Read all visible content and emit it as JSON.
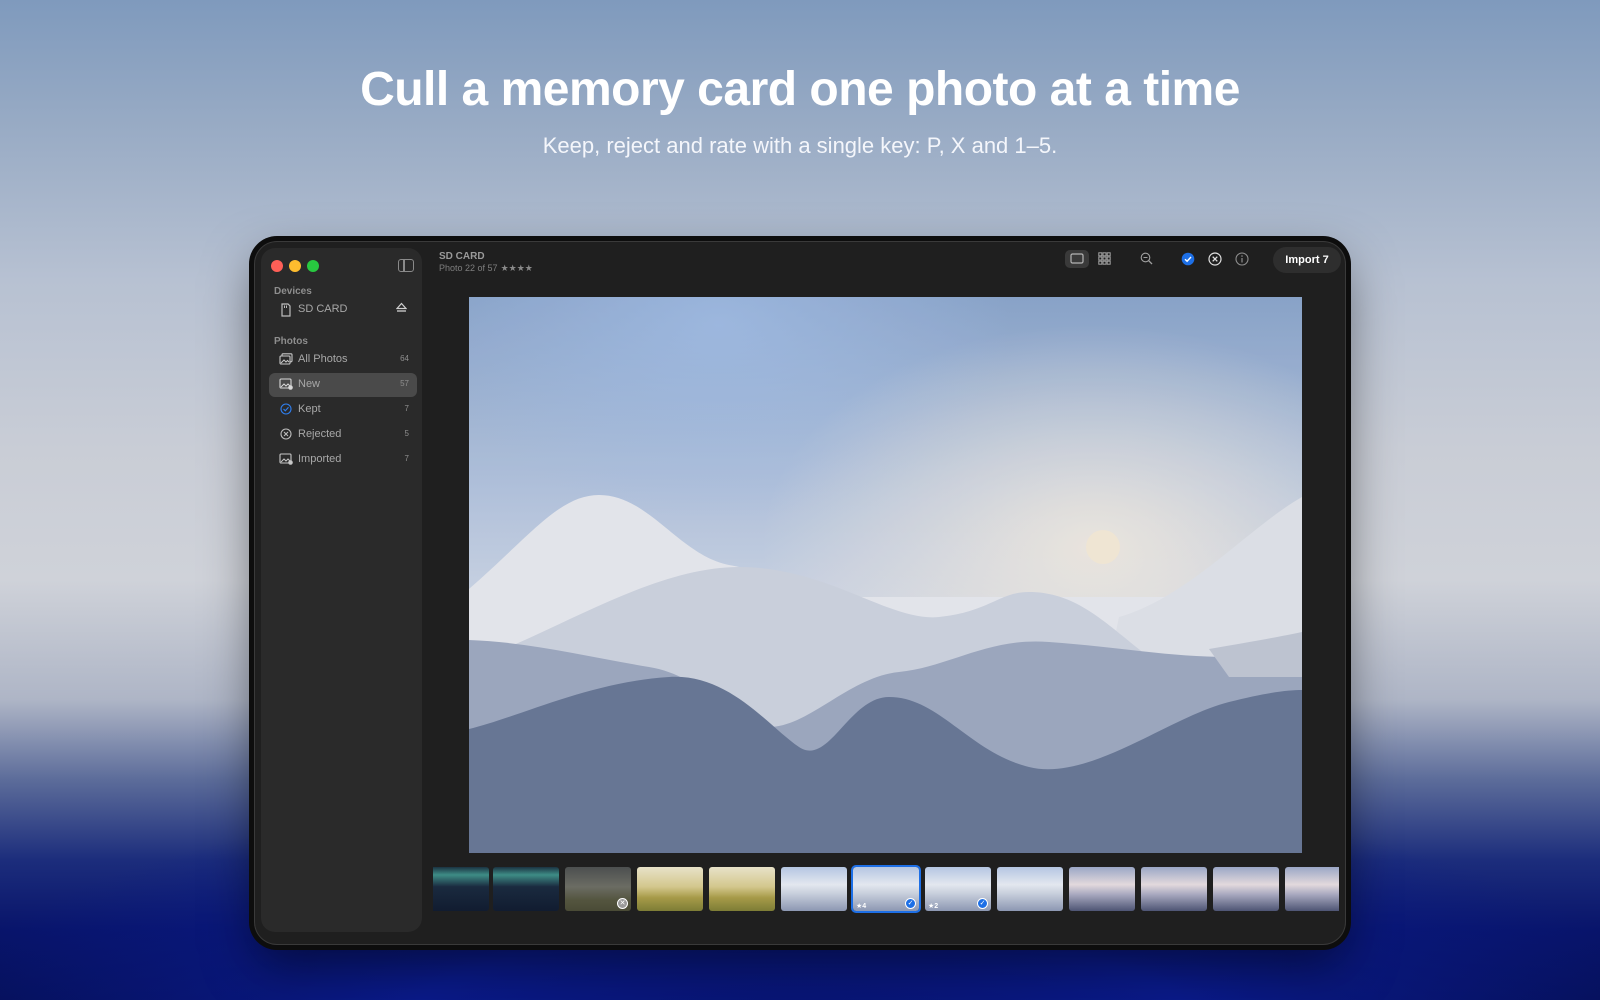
{
  "hero": {
    "title": "Cull a memory card one photo at a time",
    "subtitle": "Keep, reject and rate with a single key: P, X and 1–5."
  },
  "colors": {
    "accent": "#1d6fe6",
    "window_bg": "#1f1f1f",
    "sidebar_bg": "#2a2a2a",
    "traffic_close": "#ff5f57",
    "traffic_min": "#febc2e",
    "traffic_max": "#28c840"
  },
  "sidebar": {
    "devices_heading": "Devices",
    "device": {
      "label": "SD CARD",
      "icon": "sd-card-icon",
      "action_icon": "eject-icon"
    },
    "photos_heading": "Photos",
    "items": [
      {
        "label": "All Photos",
        "count": "64",
        "icon": "photo-stack-icon",
        "selected": false
      },
      {
        "label": "New",
        "count": "57",
        "icon": "photo-new-icon",
        "selected": true
      },
      {
        "label": "Kept",
        "count": "7",
        "icon": "checkmark-circle-icon",
        "selected": false
      },
      {
        "label": "Rejected",
        "count": "5",
        "icon": "xmark-circle-icon",
        "selected": false
      },
      {
        "label": "Imported",
        "count": "7",
        "icon": "photo-imported-icon",
        "selected": false
      }
    ]
  },
  "toolbar": {
    "title": "SD CARD",
    "subtitle": "Photo 22 of 57",
    "stars": "★★★★",
    "import_label": "Import 7",
    "buttons": [
      "single-view-icon",
      "grid-view-icon",
      "zoom-icon",
      "keep-icon",
      "reject-icon",
      "info-icon"
    ]
  },
  "filmstrip": {
    "thumbs": [
      {
        "style": "aurora",
        "status": "none",
        "rating": "",
        "selected": false
      },
      {
        "style": "aurora",
        "status": "none",
        "rating": "",
        "selected": false
      },
      {
        "style": "dim-field",
        "status": "rejected",
        "rating": "",
        "selected": false
      },
      {
        "style": "gold-field",
        "status": "none",
        "rating": "",
        "selected": false
      },
      {
        "style": "gold-field",
        "status": "none",
        "rating": "",
        "selected": false
      },
      {
        "style": "pale-hills",
        "status": "none",
        "rating": "",
        "selected": false
      },
      {
        "style": "pale-hills",
        "status": "kept",
        "rating": "★4",
        "selected": true
      },
      {
        "style": "pale-hills",
        "status": "kept",
        "rating": "★2",
        "selected": false
      },
      {
        "style": "pale-hills",
        "status": "none",
        "rating": "",
        "selected": false
      },
      {
        "style": "dusk-hills",
        "status": "none",
        "rating": "",
        "selected": false
      },
      {
        "style": "dusk-hills",
        "status": "none",
        "rating": "",
        "selected": false
      },
      {
        "style": "dusk-hills",
        "status": "none",
        "rating": "",
        "selected": false
      },
      {
        "style": "dusk-hills",
        "status": "none",
        "rating": "",
        "selected": false
      }
    ]
  }
}
